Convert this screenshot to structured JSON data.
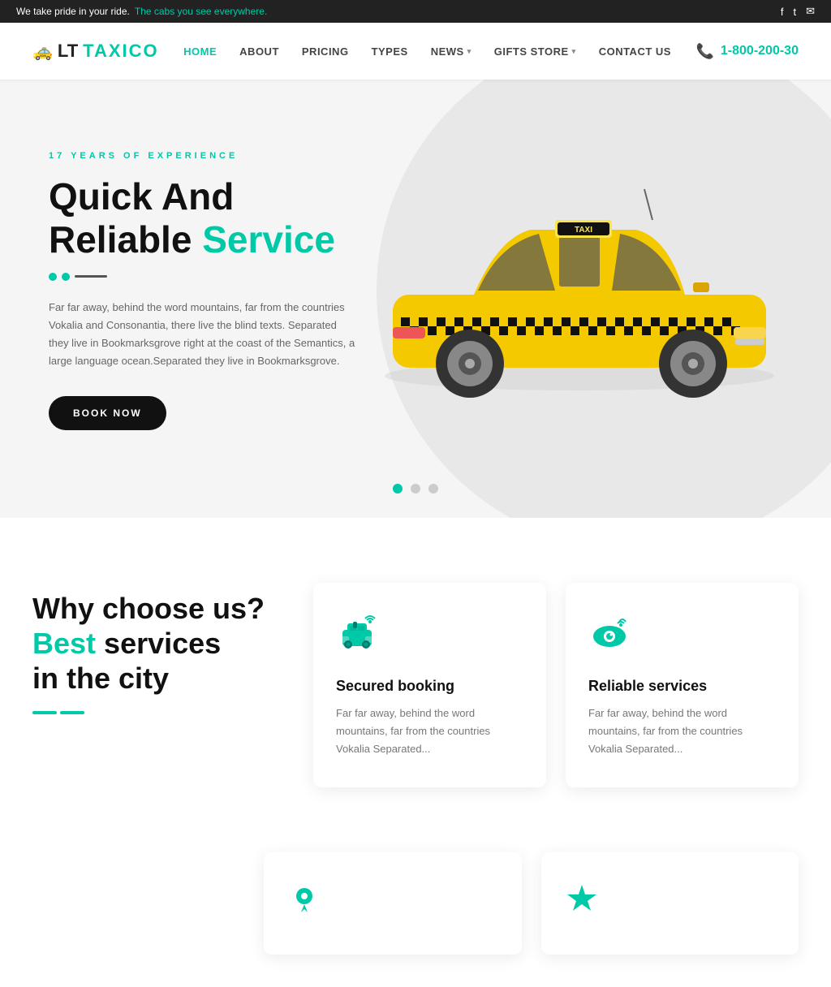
{
  "topbar": {
    "message_prefix": "We take pride in your ride.",
    "message_highlight": "The cabs you see everywhere.",
    "icons": [
      "facebook",
      "twitter",
      "email"
    ]
  },
  "header": {
    "logo_prefix": "LT",
    "logo_suffix": "TAXICO",
    "nav_items": [
      {
        "label": "HOME",
        "active": true,
        "has_dropdown": false
      },
      {
        "label": "ABOUT",
        "active": false,
        "has_dropdown": false
      },
      {
        "label": "PRICING",
        "active": false,
        "has_dropdown": false
      },
      {
        "label": "TYPES",
        "active": false,
        "has_dropdown": false
      },
      {
        "label": "NEWS",
        "active": false,
        "has_dropdown": true
      },
      {
        "label": "GIFTS STORE",
        "active": false,
        "has_dropdown": true
      },
      {
        "label": "CONTACT US",
        "active": false,
        "has_dropdown": false
      }
    ],
    "phone": "1-800-200-30"
  },
  "hero": {
    "experience_label": "17 YEARS OF EXPERIENCE",
    "title_line1": "Quick And",
    "title_line2_normal": "Reliable",
    "title_line2_accent": "Service",
    "description": "Far far away, behind the word mountains, far from the countries Vokalia and Consonantia, there live the blind texts. Separated they live in Bookmarksgrove right at the coast of the Semantics, a large language ocean.Separated they live in Bookmarksgrove.",
    "book_button": "BOOK NOW",
    "slider_dots": [
      "active",
      "inactive",
      "inactive"
    ]
  },
  "features": {
    "heading_line1": "Why choose us?",
    "heading_line2_normal": "",
    "heading_accent": "Best",
    "heading_line3_normal": "services",
    "heading_line4": "in the city",
    "cards": [
      {
        "icon": "taxi",
        "title": "Secured booking",
        "description": "Far far away, behind the word mountains, far from the countries Vokalia Separated..."
      },
      {
        "icon": "eye",
        "title": "Reliable services",
        "description": "Far far away, behind the word mountains, far from the countries Vokalia Separated..."
      },
      {
        "icon": "map",
        "title": "",
        "description": ""
      },
      {
        "icon": "star",
        "title": "",
        "description": ""
      }
    ]
  }
}
